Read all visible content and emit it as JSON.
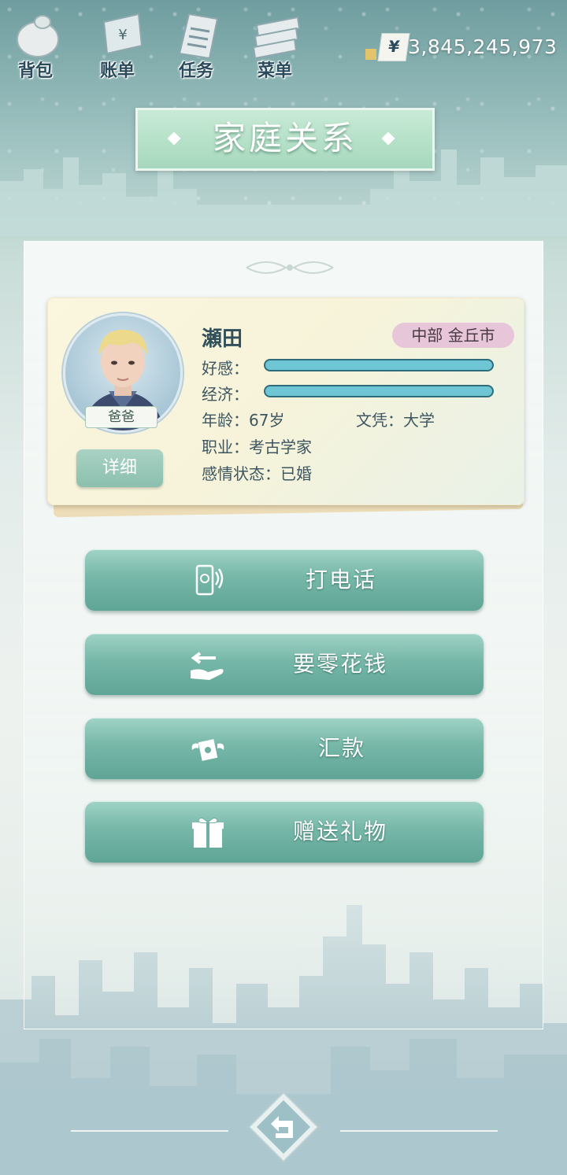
{
  "top_nav": [
    {
      "label": "背包",
      "icon": "backpack-icon"
    },
    {
      "label": "账单",
      "icon": "bill-icon"
    },
    {
      "label": "任务",
      "icon": "task-icon"
    },
    {
      "label": "菜单",
      "icon": "menu-icon"
    }
  ],
  "money": {
    "currency": "¥",
    "amount": "3,845,245,973"
  },
  "page_title": "家庭关系",
  "profile": {
    "name": "瀬田",
    "location": "中部 金丘市",
    "relation": "爸爸",
    "detail_label": "详细",
    "favor_label": "好感：",
    "favor_level": 1.0,
    "economy_label": "经济：",
    "economy_level": 1.0,
    "age": "年龄：67岁",
    "education": "文凭：大学",
    "job": "职业：考古学家",
    "marital": "感情状态：已婚"
  },
  "actions": [
    {
      "label": "打电话",
      "icon": "phone-icon"
    },
    {
      "label": "要零花钱",
      "icon": "hand-money-icon"
    },
    {
      "label": "汇款",
      "icon": "money-wings-icon"
    },
    {
      "label": "赠送礼物",
      "icon": "gift-icon"
    }
  ],
  "colors": {
    "accent": "#76b7a8",
    "bar": "#6ec6d4",
    "location_tag": "#e8c6d9"
  }
}
